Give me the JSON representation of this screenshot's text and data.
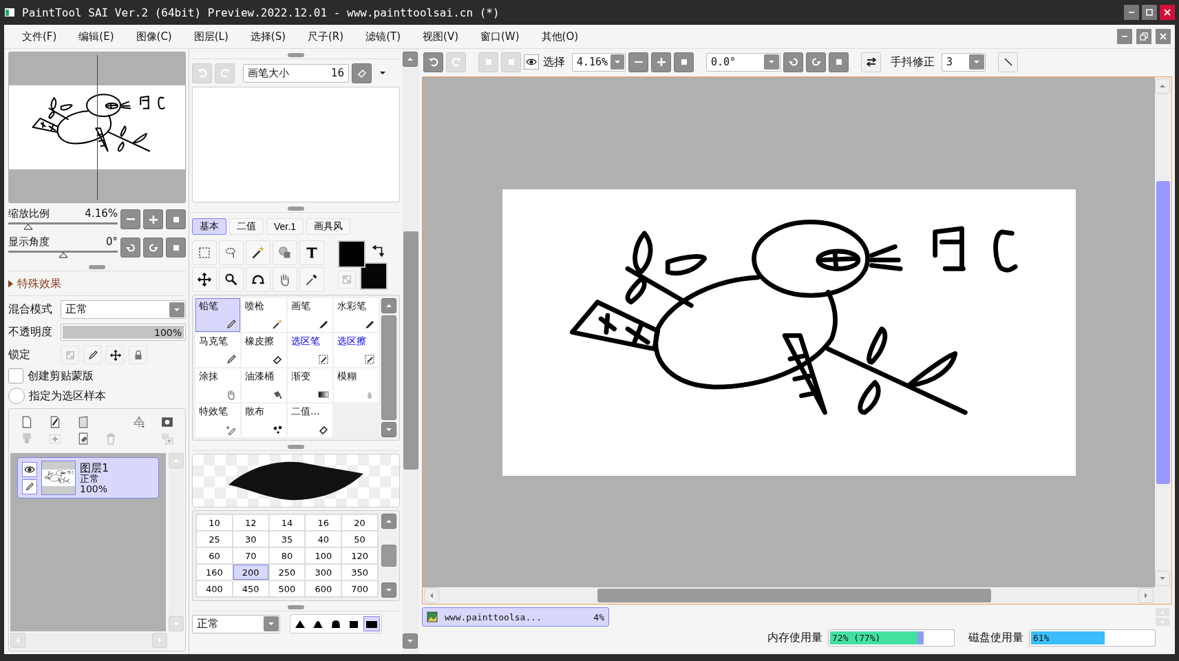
{
  "window": {
    "title": "PaintTool SAI Ver.2 (64bit) Preview.2022.12.01 - www.painttoolsai.cn (*)"
  },
  "menu": [
    "文件(F)",
    "编辑(E)",
    "图像(C)",
    "图层(L)",
    "选择(S)",
    "尺子(R)",
    "滤镜(T)",
    "视图(V)",
    "窗口(W)",
    "其他(O)"
  ],
  "navigator": {
    "zoom": {
      "label": "缩放比例",
      "value": "4.16%",
      "level": 0.18
    },
    "angle": {
      "label": "显示角度",
      "value": "0°",
      "level": 0.5
    }
  },
  "effects": {
    "label": "特殊效果",
    "expanded": false
  },
  "layer_props": {
    "blend_label": "混合模式",
    "blend_value": "正常",
    "opacity": {
      "label": "不透明度",
      "value": "100%",
      "level": 1
    },
    "lock_label": "锁定",
    "clip": {
      "label": "创建剪贴蒙版",
      "checked": false
    },
    "sample": {
      "label": "指定为选区样本",
      "checked": false
    }
  },
  "layers": [
    {
      "name": "图层1",
      "mode": "正常",
      "opacity": "100%",
      "selected": true,
      "visible": true
    }
  ],
  "brush_size": {
    "label": "画笔大小",
    "value": "16"
  },
  "tool_tabs": [
    {
      "label": "基本",
      "selected": true
    },
    {
      "label": "二值",
      "selected": false
    },
    {
      "label": "Ver.1",
      "selected": false
    },
    {
      "label": "画具风",
      "selected": false
    }
  ],
  "tools": [
    {
      "label": "铅笔",
      "kind": "brush",
      "selected": true
    },
    {
      "label": "喷枪",
      "kind": "brush",
      "selected": false
    },
    {
      "label": "画笔",
      "kind": "brush",
      "selected": false
    },
    {
      "label": "水彩笔",
      "kind": "brush",
      "selected": false
    },
    {
      "label": "马克笔",
      "kind": "brush",
      "selected": false
    },
    {
      "label": "橡皮擦",
      "kind": "brush",
      "selected": false
    },
    {
      "label": "选区笔",
      "kind": "selection",
      "selected": false
    },
    {
      "label": "选区擦",
      "kind": "selection",
      "selected": false
    },
    {
      "label": "涂抹",
      "kind": "brush",
      "selected": false
    },
    {
      "label": "油漆桶",
      "kind": "brush",
      "selected": false
    },
    {
      "label": "渐变",
      "kind": "brush",
      "selected": false
    },
    {
      "label": "模糊",
      "kind": "brush",
      "selected": false
    },
    {
      "label": "特效笔",
      "kind": "brush",
      "selected": false
    },
    {
      "label": "散布",
      "kind": "brush",
      "selected": false
    },
    {
      "label": "二值...",
      "kind": "brush",
      "selected": false
    }
  ],
  "sizes": [
    {
      "label": "10",
      "selected": false
    },
    {
      "label": "12",
      "selected": false
    },
    {
      "label": "14",
      "selected": false
    },
    {
      "label": "16",
      "selected": false
    },
    {
      "label": "20",
      "selected": false
    },
    {
      "label": "25",
      "selected": false
    },
    {
      "label": "30",
      "selected": false
    },
    {
      "label": "35",
      "selected": false
    },
    {
      "label": "40",
      "selected": false
    },
    {
      "label": "50",
      "selected": false
    },
    {
      "label": "60",
      "selected": false
    },
    {
      "label": "70",
      "selected": false
    },
    {
      "label": "80",
      "selected": false
    },
    {
      "label": "100",
      "selected": false
    },
    {
      "label": "120",
      "selected": false
    },
    {
      "label": "160",
      "selected": false
    },
    {
      "label": "200",
      "selected": true
    },
    {
      "label": "250",
      "selected": false
    },
    {
      "label": "300",
      "selected": false
    },
    {
      "label": "350",
      "selected": false
    },
    {
      "label": "400",
      "selected": false
    },
    {
      "label": "450",
      "selected": false
    },
    {
      "label": "500",
      "selected": false
    },
    {
      "label": "600",
      "selected": false
    },
    {
      "label": "700",
      "selected": false
    }
  ],
  "brush_blend": "正常",
  "brush_shapes": [
    {
      "selected": false
    },
    {
      "selected": false
    },
    {
      "selected": false
    },
    {
      "selected": false
    },
    {
      "selected": true
    }
  ],
  "toolbar": {
    "select_label": "选择",
    "zoom": "4.16%",
    "angle": "0.0°",
    "stabilizer_label": "手抖修正",
    "stabilizer": "3"
  },
  "documents": [
    {
      "name": "www.painttoolsa...",
      "zoom": "4%",
      "selected": true
    }
  ],
  "status": {
    "memory": {
      "label": "内存使用量",
      "value": "72% (77%)",
      "level": 0.72,
      "peak": {
        "level": 0.77
      }
    },
    "disk": {
      "label": "磁盘使用量",
      "value": "61%",
      "level": 0.61
    }
  }
}
